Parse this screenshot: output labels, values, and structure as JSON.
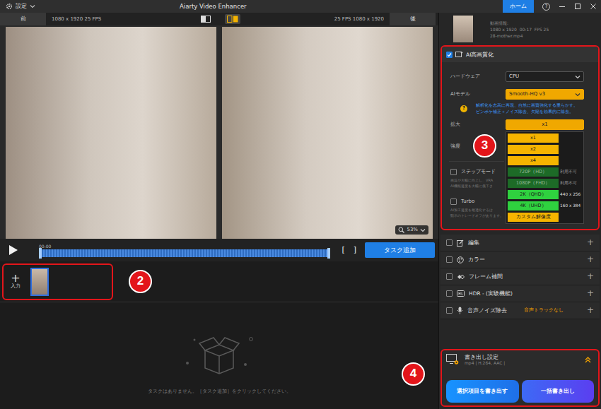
{
  "window": {
    "settings_label": "設定",
    "title": "Aiarty Video Enhancer",
    "home_button": "ホーム",
    "help": "?"
  },
  "preview": {
    "before_label": "前",
    "before_info": "1080 x 1920 25 FPS",
    "view_modes": [
      {
        "selected": false
      },
      {
        "selected": true
      }
    ],
    "after_info": "25 FPS 1080 x 1920",
    "after_label": "後",
    "zoom": "53%"
  },
  "player": {
    "time": "00:00",
    "level": 0,
    "in_mark": "[",
    "out_mark": "]",
    "add_task_button": "タスク追加"
  },
  "inputs": {
    "add_icon": "+",
    "add_label": "入力",
    "clips": [
      {
        "selected": true
      }
    ]
  },
  "tasks": {
    "empty_message": "タスクはありません。［タスク追加］をクリックしてください。"
  },
  "video_info": {
    "title": "動画情報:",
    "details": "1080 x 1920  00:17  FPS 25",
    "file": "28-mother.mp4"
  },
  "enhance": {
    "label": "AI高画質化",
    "checked": true,
    "hardware_label": "ハードウェア",
    "hardware": "CPU",
    "model_label": "AIモデル",
    "model": "Smooth-HQ v3",
    "help": "?",
    "model_description": [
      "解析化を志高に再現、自然に画質強化する重らかす。",
      "ピンボケ補正＋ノイズ除去、欠陥を効果的に除去。"
    ],
    "scale_label": "拡大",
    "scale": "x1",
    "scale_options": [
      {
        "label": "x1",
        "disabled": false,
        "color": "#f5b400"
      },
      {
        "label": "x2",
        "disabled": false,
        "color": "#f5b400"
      },
      {
        "label": "x4",
        "disabled": false,
        "color": "#f5b400"
      },
      {
        "label": "720P（HD）",
        "detail": "利用不可",
        "disabled": true,
        "color": "#1d6b27"
      },
      {
        "label": "1080P（FHD）",
        "detail": "利用不可",
        "disabled": true,
        "color": "#1d6b27"
      },
      {
        "label": "2K（QHD）",
        "detail": "440 x 256",
        "disabled": false,
        "color": "#2fd13f"
      },
      {
        "label": "4K（UHD）",
        "detail": "160 x 384",
        "disabled": false,
        "color": "#2fd13f"
      },
      {
        "label": "カスタム解像度",
        "disabled": false,
        "color": "#f5b400"
      }
    ],
    "strength_label": "強度",
    "step_mode": {
      "label": "ステップモード",
      "checked": false,
      "description": [
        "画質が大幅に向上し、VRA",
        "AI機能速度を大幅に低下さ"
      ]
    },
    "turbo": {
      "label": "Turbo",
      "checked": false,
      "description": [
        "AI加工速度を最適化するは",
        "顕示のトレードオフがあります。"
      ]
    }
  },
  "features": [
    {
      "label": "編集",
      "checked": false,
      "expand": "+"
    },
    {
      "label": "カラー",
      "checked": false,
      "expand": "+"
    },
    {
      "label": "フレーム補間",
      "checked": false,
      "expand": "+"
    },
    {
      "label": "HDR - (実験機能)",
      "checked": false,
      "expand": "+"
    },
    {
      "label": "音声ノイズ除去",
      "checked": false,
      "note": "音声トラックなし",
      "expand": "+"
    }
  ],
  "export": {
    "title": "書き出し設定",
    "format": "mp4 | H.264, AAC |",
    "export_selected_button": "選択項目を書き出す",
    "export_all_button": "一括書き出し"
  },
  "annotations": [
    {
      "number": "2"
    },
    {
      "number": "3"
    },
    {
      "number": "4"
    }
  ]
}
